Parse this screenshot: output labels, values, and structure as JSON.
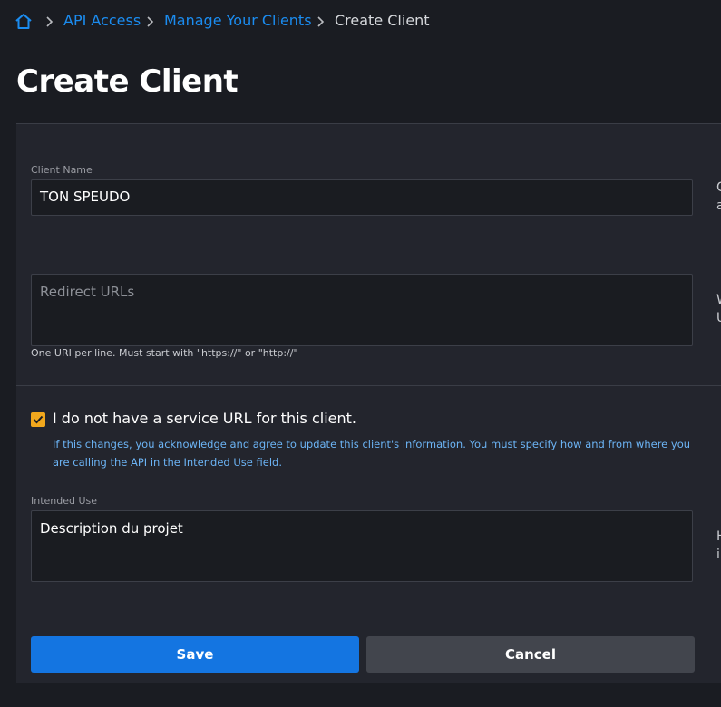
{
  "breadcrumb": {
    "home_icon": "home-icon",
    "items": [
      "API Access",
      "Manage Your Clients"
    ],
    "current": "Create Client",
    "separator_icon": "chevron-right-icon"
  },
  "page": {
    "title": "Create Client"
  },
  "form": {
    "client_name": {
      "label": "Client Name",
      "value": "TON SPEUDO",
      "side_text": [
        "C",
        "a"
      ]
    },
    "redirect_urls": {
      "placeholder": "Redirect URLs",
      "value": "",
      "help": "One URI per line. Must start with \"https://\" or \"http://\"",
      "side_text": [
        "W",
        "U"
      ]
    },
    "no_service_url": {
      "checked": true,
      "label": "I do not have a service URL for this client.",
      "info": "If this changes, you acknowledge and agree to update this client's information. You must specify how and from where you are calling the API in the Intended Use field."
    },
    "intended_use": {
      "label": "Intended Use",
      "value": "Description du projet",
      "side_text": [
        "H",
        "i"
      ]
    }
  },
  "actions": {
    "save_label": "Save",
    "cancel_label": "Cancel"
  },
  "colors": {
    "accent": "#1475e1",
    "link": "#1b8cf0",
    "checkbox": "#f2a81d",
    "info_text": "#6cb4f5",
    "background": "#1a1c22",
    "panel": "#23252d"
  }
}
